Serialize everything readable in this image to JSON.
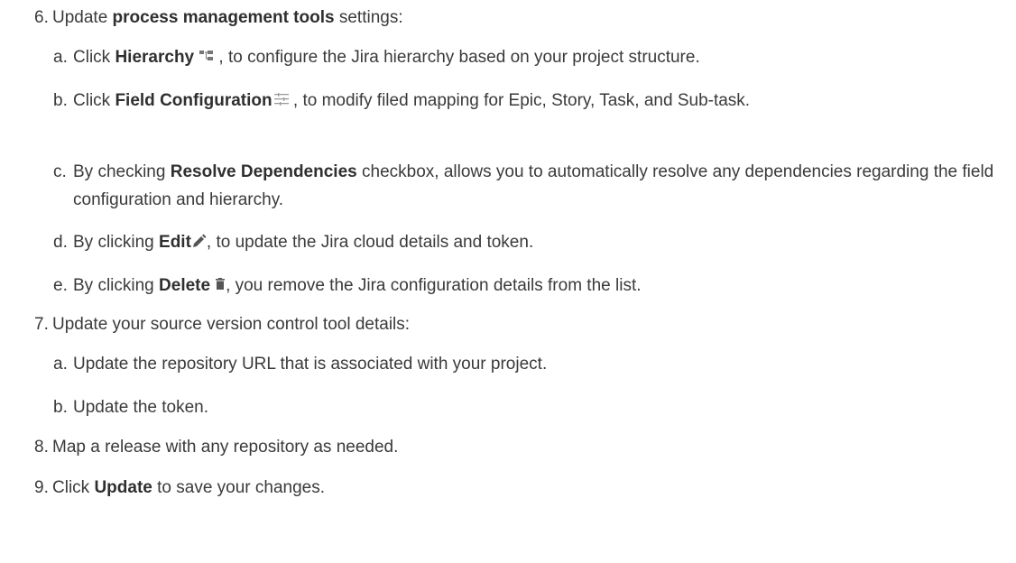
{
  "steps": [
    {
      "num": "6.",
      "text_before": "Update ",
      "bold": "process management tools",
      "text_after": " settings:",
      "subs": [
        {
          "num": "a.",
          "pre": "Click ",
          "bold": "Hierarchy",
          "icon": "hierarchy-icon",
          "post": " , to configure the Jira hierarchy based on your project structure."
        },
        {
          "num": "b.",
          "pre": "Click ",
          "bold": "Field Configuration",
          "icon": "field-configuration-icon",
          "post": " , to modify filed mapping for Epic, Story, Task, and Sub-task."
        },
        {
          "num": "c.",
          "pre": "By checking ",
          "bold": "Resolve Dependencies",
          "post": " checkbox, allows you to automatically resolve any dependencies regarding the field configuration and hierarchy."
        },
        {
          "num": "d.",
          "pre": "By clicking ",
          "bold": "Edit",
          "icon": "pencil-icon",
          "post": ", to update the Jira cloud details and token."
        },
        {
          "num": "e.",
          "pre": "By clicking ",
          "bold": "Delete",
          "icon": "trash-icon",
          "post": ", you remove the Jira configuration details from the list."
        }
      ]
    },
    {
      "num": "7.",
      "text_before": "Update your source version control tool details:",
      "subs": [
        {
          "num": "a.",
          "pre": "Update the repository URL that is associated with your project."
        },
        {
          "num": "b.",
          "pre": "Update the token."
        }
      ]
    },
    {
      "num": "8.",
      "text_before": "Map a release with any repository as needed."
    },
    {
      "num": "9.",
      "text_before": "Click ",
      "bold": "Update",
      "text_after": " to save your changes."
    }
  ]
}
